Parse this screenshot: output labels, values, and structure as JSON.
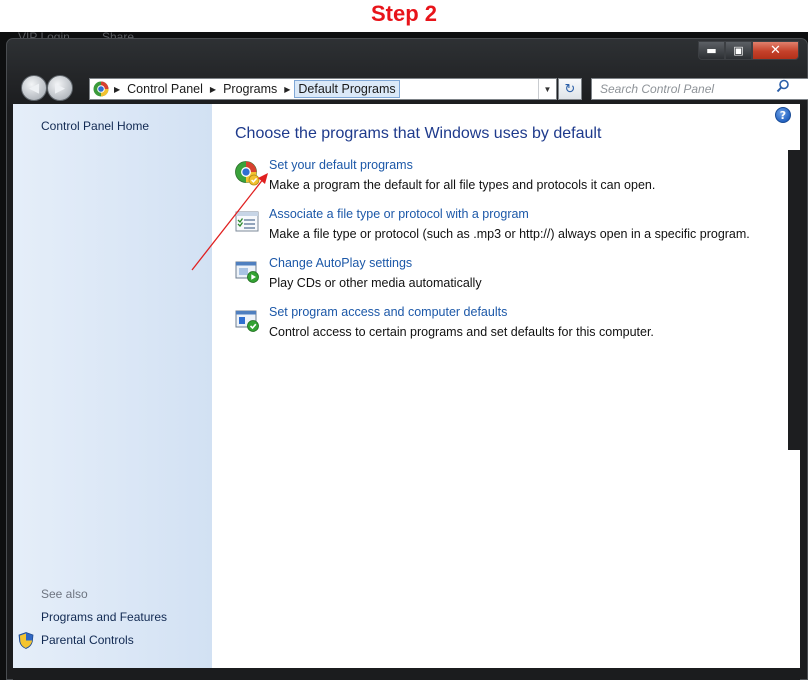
{
  "step_heading": "Step 2",
  "background_text": {
    "vip": "VIP Login",
    "share": "Share"
  },
  "window_controls": {
    "minimize": "▬",
    "maximize": "▣",
    "close": "✕"
  },
  "nav": {
    "back": "◀",
    "forward": "▶"
  },
  "address_bar": {
    "crumbs": [
      "Control Panel",
      "Programs",
      "Default Programs"
    ],
    "separator": "▶",
    "dropdown": "▼",
    "refresh": "↻"
  },
  "search": {
    "placeholder": "Search Control Panel"
  },
  "sidebar": {
    "home_link": "Control Panel Home",
    "see_also_heading": "See also",
    "see_also_items": [
      "Programs and Features",
      "Parental Controls"
    ]
  },
  "main": {
    "help": "?",
    "title": "Choose the programs that Windows uses by default",
    "tasks": [
      {
        "link": "Set your default programs",
        "description": "Make a program the default for all file types and protocols it can open.",
        "icon": "default-programs-icon"
      },
      {
        "link": "Associate a file type or protocol with a program",
        "description": "Make a file type or protocol (such as .mp3 or http://) always open in a specific program.",
        "icon": "file-association-icon"
      },
      {
        "link": "Change AutoPlay settings",
        "description": "Play CDs or other media automatically",
        "icon": "autoplay-icon"
      },
      {
        "link": "Set program access and computer defaults",
        "description": "Control access to certain programs and set defaults for this computer.",
        "icon": "program-access-icon"
      }
    ]
  },
  "colors": {
    "step_heading": "#e8141a",
    "title": "#1e3a8c",
    "link": "#1c58a8",
    "annotation_arrow": "#e02020"
  }
}
